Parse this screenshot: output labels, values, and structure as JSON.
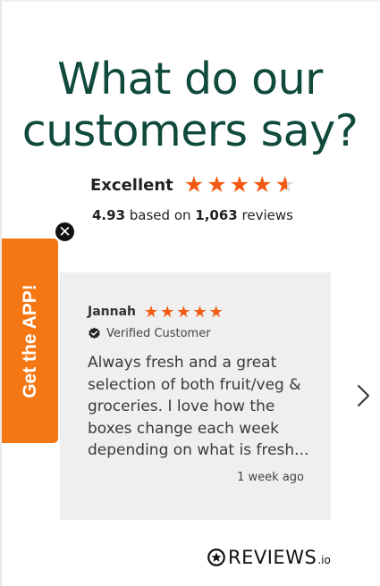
{
  "widget": {
    "heading_line1": "What do our",
    "heading_line2": "customers say?",
    "rating_word": "Excellent",
    "overall_rating": 4.93,
    "overall_rating_text": "4.93",
    "summary_middle": " based on ",
    "review_count": "1,063",
    "summary_suffix": " reviews",
    "star_glyph": "★",
    "accent_color": "#f25a13",
    "heading_color": "#0f4a3c"
  },
  "app_tab": {
    "label": "Get the APP!",
    "close_glyph": "✕",
    "color": "#f57713"
  },
  "review": {
    "name": "Jannah",
    "rating": 5,
    "verified_label": "Verified Customer",
    "text": "Always fresh and a great selection of both fruit/veg & groceries. I love how the boxes change each week depending on what is fresh...",
    "date": "1 week ago"
  },
  "navigation": {
    "next_icon": "chevron-right-icon"
  },
  "brand": {
    "name": "REVIEWS",
    "tld": ".io"
  }
}
